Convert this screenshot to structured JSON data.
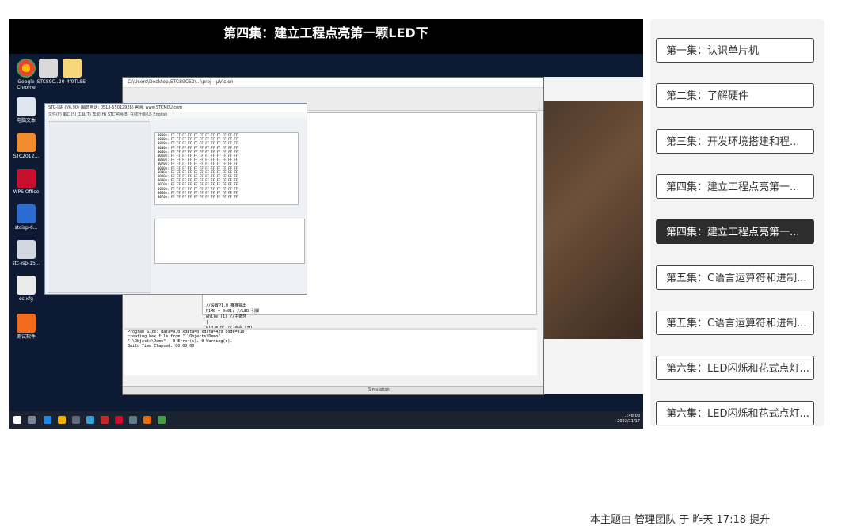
{
  "video": {
    "title": "第四集：建立工程点亮第一颗LED下"
  },
  "desktop": {
    "icons": [
      "Google Chrome",
      "STC89C...",
      "20-4f0TLSE",
      "电脑文本",
      "STC...",
      "STC2012...",
      "WPS Office",
      "stcisp-6...",
      "stc-isp-15...",
      "cc.xfg",
      "测试软件"
    ]
  },
  "ide": {
    "title_text": "C:\\Users\\Desktop\\STC89C52\\...\\proj - µVision",
    "code_lines": [
      "//设置P1.0 推挽输出",
      "P1M0 = 0x01;     //LED 引脚",
      "while (1)  //主循环",
      "{",
      "    P10 = 0;  // 点亮 LED",
      "}"
    ],
    "build_lines": [
      "Program Size: data=9.0 xdata=0 xdata=420 code=910",
      "creating hex file from \".\\Objects\\Demo\"...",
      "\".\\Objects\\Demo\" - 0 Error(s), 0 Warning(s).",
      "Build Time Elapsed:  00:00:00"
    ],
    "status_text": "Simulation"
  },
  "isp": {
    "title_text": "STC-ISP (V6.90) (销售电话: 0513-55012928) 官网: www.STCMCU.com",
    "menu_text": "文件(F)  串口(S)  工具(T)  帮助(H)  STC官网(B)  在线升级(U)  English",
    "hex_lines": [
      "0000h: FF FF FF FF FF FF FF FF FF FF FF FF",
      "0010h: FF FF FF FF FF FF FF FF FF FF FF FF",
      "0020h: FF FF FF FF FF FF FF FF FF FF FF FF",
      "0030h: FF FF FF FF FF FF FF FF FF FF FF FF",
      "0040h: FF FF FF FF FF FF FF FF FF FF FF FF",
      "0050h: FF FF FF FF FF FF FF FF FF FF FF FF",
      "0060h: FF FF FF FF FF FF FF FF FF FF FF FF",
      "0070h: FF FF FF FF FF FF FF FF FF FF FF FF",
      "0080h: FF FF FF FF FF FF FF FF FF FF FF FF",
      "0090h: FF FF FF FF FF FF FF FF FF FF FF FF",
      "00A0h: FF FF FF FF FF FF FF FF FF FF FF FF",
      "00B0h: FF FF FF FF FF FF FF FF FF FF FF FF",
      "00C0h: FF FF FF FF FF FF FF FF FF FF FF FF",
      "00D0h: FF FF FF FF FF FF FF FF FF FF FF FF",
      "00E0h: FF FF FF FF FF FF FF FF FF FF FF FF",
      "00F0h: FF FF FF FF FF FF FF FF FF FF FF FF"
    ]
  },
  "taskbar": {
    "clock_line1": "1:48:08",
    "clock_line2": "2022/11/17"
  },
  "playlist": {
    "episodes": [
      {
        "label": "第一集：认识单片机",
        "active": false
      },
      {
        "label": "第二集：了解硬件",
        "active": false
      },
      {
        "label": "第三集：开发环境搭建和程...",
        "active": false
      },
      {
        "label": "第四集：建立工程点亮第一...",
        "active": false
      },
      {
        "label": "第四集：建立工程点亮第一...",
        "active": true
      },
      {
        "label": "第五集：C语言运算符和进制...",
        "active": false
      },
      {
        "label": "第五集：C语言运算符和进制...",
        "active": false
      },
      {
        "label": "第六集：LED闪烁和花式点灯...",
        "active": false
      },
      {
        "label": "第六集：LED闪烁和花式点灯...",
        "active": false
      }
    ]
  },
  "footer": {
    "note": "本主题由 管理团队 于 昨天 17:18 提升"
  },
  "colors": {
    "active_episode": "#2d2d2d",
    "playlist_bg": "#f3f3f3",
    "video_bg": "#000000"
  }
}
